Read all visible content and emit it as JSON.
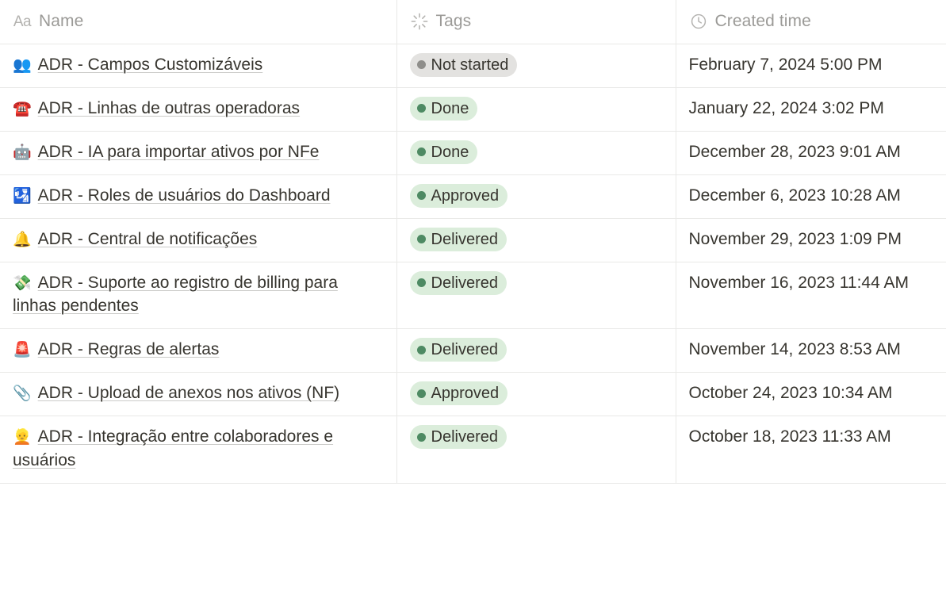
{
  "view": {
    "type": "database-table",
    "background": "#ffffff",
    "border_color": "#e9e9e7",
    "text_color": "#37352f",
    "muted_text_color": "#9b9a97"
  },
  "columns": [
    {
      "id": "name",
      "label": "Name",
      "icon": "title-aa-icon"
    },
    {
      "id": "tags",
      "label": "Tags",
      "icon": "multi-select-starburst-icon"
    },
    {
      "id": "time",
      "label": "Created time",
      "icon": "clock-icon"
    }
  ],
  "tag_styles": {
    "Not started": {
      "bg": "#e3e2e0",
      "dot": "#8f8e8b",
      "text": "#37352f"
    },
    "Done": {
      "bg": "#dbeddb",
      "dot": "#4e8a63",
      "text": "#37352f"
    },
    "Approved": {
      "bg": "#dbeddb",
      "dot": "#4e8a63",
      "text": "#37352f"
    },
    "Delivered": {
      "bg": "#dbeddb",
      "dot": "#4e8a63",
      "text": "#37352f"
    }
  },
  "rows": [
    {
      "emoji": "👥",
      "emoji_name": "busts-in-silhouette-emoji",
      "name": "ADR - Campos Customizáveis",
      "tag": "Not started",
      "created_time": "February 7, 2024 5:00 PM"
    },
    {
      "emoji": "☎️",
      "emoji_name": "telephone-emoji",
      "name": "ADR - Linhas de outras operadoras",
      "tag": "Done",
      "created_time": "January 22, 2024 3:02 PM"
    },
    {
      "emoji": "🤖",
      "emoji_name": "robot-emoji",
      "name": "ADR - IA para importar ativos por NFe",
      "tag": "Done",
      "created_time": "December 28, 2023 9:01 AM"
    },
    {
      "emoji": "🛂",
      "emoji_name": "passport-control-emoji",
      "name": "ADR - Roles de usuários do Dashboard",
      "tag": "Approved",
      "created_time": "December 6, 2023 10:28 AM"
    },
    {
      "emoji": "🔔",
      "emoji_name": "bell-emoji",
      "name": "ADR - Central de notificações",
      "tag": "Delivered",
      "created_time": "November 29, 2023 1:09 PM"
    },
    {
      "emoji": "💸",
      "emoji_name": "money-with-wings-emoji",
      "name": "ADR - Suporte ao registro de billing para linhas pendentes",
      "tag": "Delivered",
      "created_time": "November 16, 2023 11:44 AM"
    },
    {
      "emoji": "🚨",
      "emoji_name": "police-car-light-emoji",
      "name": "ADR - Regras de alertas",
      "tag": "Delivered",
      "created_time": "November 14, 2023 8:53 AM"
    },
    {
      "emoji": "📎",
      "emoji_name": "paperclip-emoji",
      "name": "ADR - Upload de anexos nos ativos (NF)",
      "tag": "Approved",
      "created_time": "October 24, 2023 10:34 AM"
    },
    {
      "emoji": "👱",
      "emoji_name": "blond-haired-person-emoji",
      "name": "ADR - Integração entre colaboradores e usuários",
      "tag": "Delivered",
      "created_time": "October 18, 2023 11:33 AM"
    }
  ]
}
